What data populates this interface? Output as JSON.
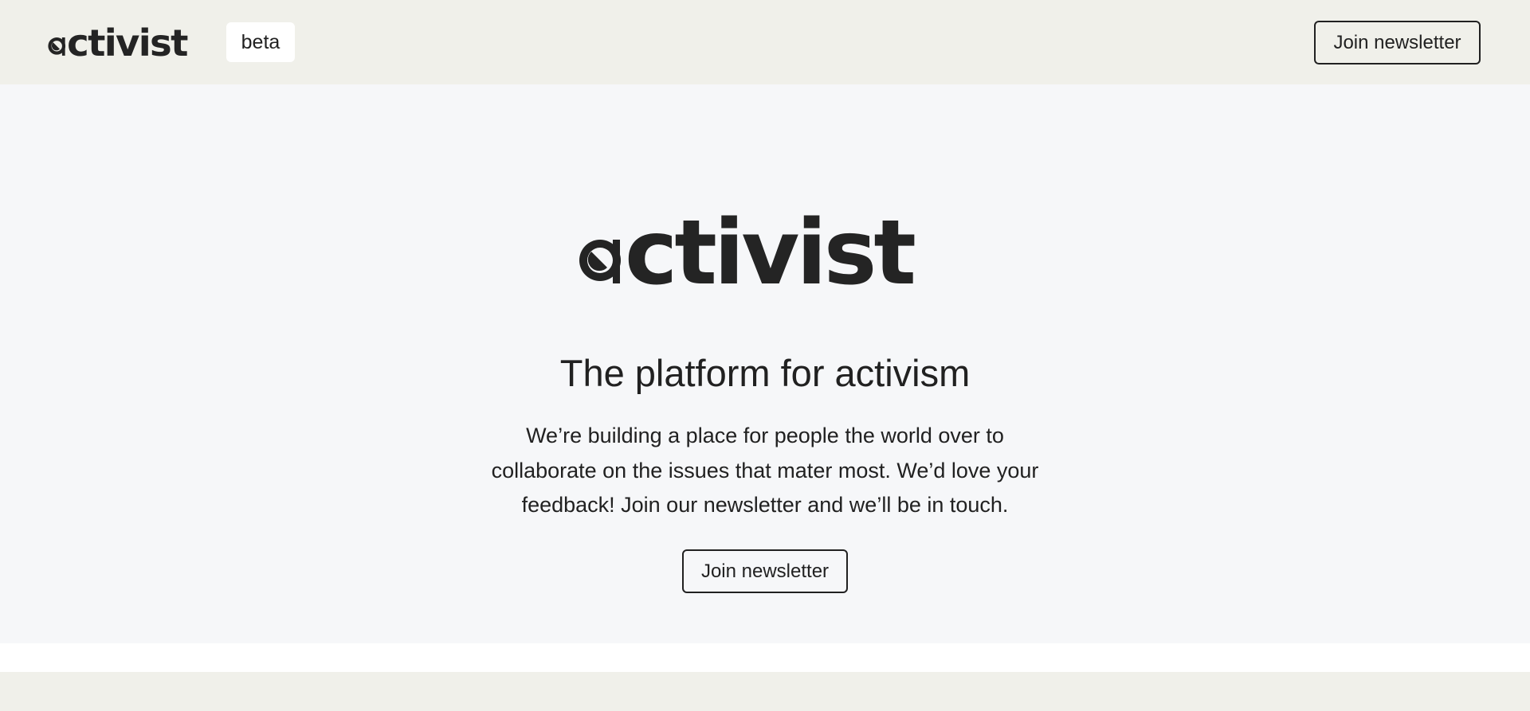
{
  "header": {
    "logo_text": "activist",
    "badge": "beta",
    "newsletter_button": "Join newsletter"
  },
  "hero": {
    "logo_text": "activist",
    "title": "The platform for activism",
    "description": "We’re building a place for people the world over to collaborate on the issues that mater most. We’d love your feedback! Join our newsletter and we’ll be in touch.",
    "newsletter_button": "Join newsletter"
  },
  "colors": {
    "header_bg": "#f0f0ea",
    "hero_bg": "#f6f7f9",
    "text": "#212121",
    "footer_bg": "#f0f0ea"
  }
}
